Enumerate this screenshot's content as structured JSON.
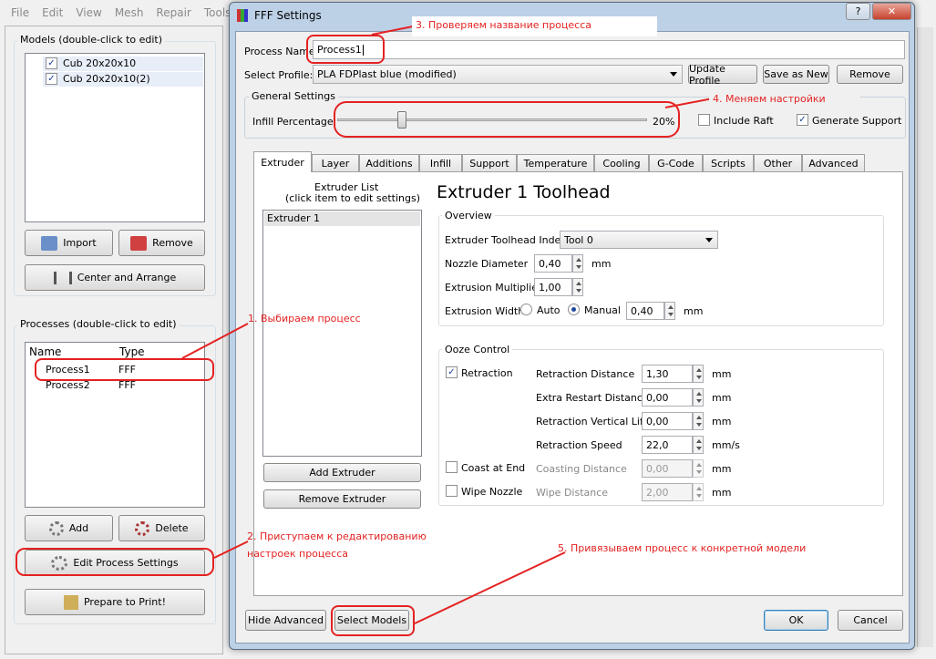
{
  "menubar": [
    "File",
    "Edit",
    "View",
    "Mesh",
    "Repair",
    "Tools"
  ],
  "models": {
    "title": "Models (double-click to edit)",
    "items": [
      "Cub 20x20x10",
      "Cub 20x20x10(2)"
    ],
    "import": "Import",
    "remove": "Remove",
    "center": "Center and Arrange"
  },
  "processes": {
    "title": "Processes (double-click to edit)",
    "col_name": "Name",
    "col_type": "Type",
    "rows": [
      {
        "name": "Process1",
        "type": "FFF"
      },
      {
        "name": "Process2",
        "type": "FFF"
      }
    ],
    "add": "Add",
    "delete": "Delete",
    "edit": "Edit Process Settings",
    "prepare": "Prepare to Print!"
  },
  "dialog": {
    "title": "FFF Settings",
    "process_name_label": "Process Name",
    "process_name": "Process1",
    "select_profile_label": "Select Profile:",
    "profile": "PLA FDPlast blue (modified)",
    "update_profile": "Update Profile",
    "save_as_new": "Save as New",
    "remove": "Remove",
    "general_settings": "General Settings",
    "infill_label": "Infill Percentage:",
    "infill_value": "20%",
    "infill_fraction": 0.2,
    "include_raft": "Include Raft",
    "generate_support": "Generate Support",
    "tabs": [
      "Extruder",
      "Layer",
      "Additions",
      "Infill",
      "Support",
      "Temperature",
      "Cooling",
      "G-Code",
      "Scripts",
      "Other",
      "Advanced"
    ],
    "extruder_list_title": "Extruder List",
    "extruder_list_sub": "(click item to edit settings)",
    "extruder_item": "Extruder 1",
    "add_extruder": "Add Extruder",
    "remove_extruder": "Remove Extruder",
    "toolhead_title": "Extruder 1 Toolhead",
    "overview": "Overview",
    "toolhead_index_label": "Extruder Toolhead Index",
    "toolhead_index": "Tool 0",
    "nozzle_label": "Nozzle Diameter",
    "nozzle": "0,40",
    "mm": "mm",
    "mms": "mm/s",
    "mult_label": "Extrusion Multiplier",
    "mult": "1,00",
    "width_label": "Extrusion Width",
    "auto": "Auto",
    "manual": "Manual",
    "width": "0,40",
    "ooze": "Ooze Control",
    "retraction": "Retraction",
    "retr_dist_label": "Retraction Distance",
    "retr_dist": "1,30",
    "extra_restart_label": "Extra Restart Distance",
    "extra_restart": "0,00",
    "vert_lift_label": "Retraction Vertical Lift",
    "vert_lift": "0,00",
    "retr_speed_label": "Retraction Speed",
    "retr_speed": "22,0",
    "coast": "Coast at End",
    "coast_dist_label": "Coasting Distance",
    "coast_dist": "0,00",
    "wipe": "Wipe Nozzle",
    "wipe_dist_label": "Wipe Distance",
    "wipe_dist": "2,00",
    "hide_advanced": "Hide Advanced",
    "select_models": "Select Models",
    "ok": "OK",
    "cancel": "Cancel"
  },
  "annotations": {
    "a1": "1. Выбираем процесс",
    "a2_line1": "2. Приступаем к редактированию",
    "a2_line2": "настроек процесса",
    "a3": "3. Проверяем название процесса",
    "a4": "4. Меняем настройки",
    "a5": "5. Привязываем процесс к конкретной модели"
  },
  "colors": {
    "annotation": "#e42222",
    "check": "#1a3e9a"
  }
}
